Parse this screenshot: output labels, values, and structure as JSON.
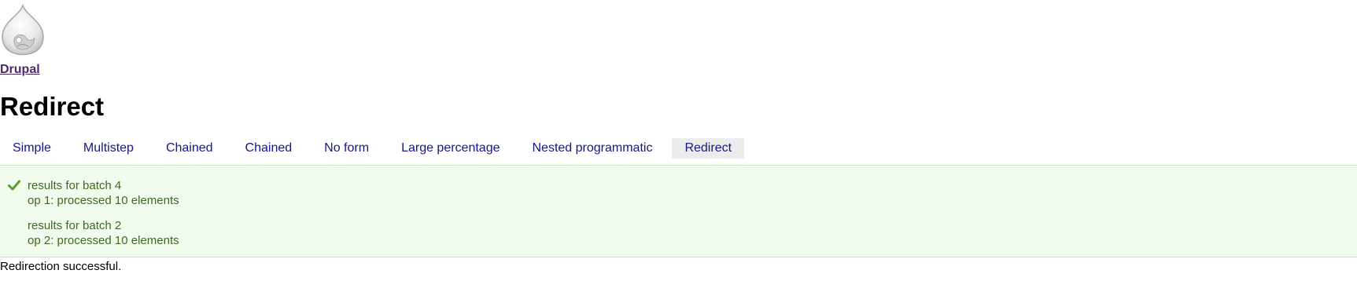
{
  "site": {
    "name": "Drupal",
    "logo_icon": "drupal-drop-icon"
  },
  "page": {
    "title": "Redirect"
  },
  "tabs": [
    {
      "label": "Simple",
      "active": false
    },
    {
      "label": "Multistep",
      "active": false
    },
    {
      "label": "Chained",
      "active": false
    },
    {
      "label": "Chained",
      "active": false
    },
    {
      "label": "No form",
      "active": false
    },
    {
      "label": "Large percentage",
      "active": false
    },
    {
      "label": "Nested programmatic",
      "active": false
    },
    {
      "label": "Redirect",
      "active": true
    }
  ],
  "messages": {
    "icon": "check-icon",
    "status_color": "#3f6a1f",
    "blocks": [
      {
        "lines": [
          "results for batch 4",
          "op 1: processed 10 elements"
        ]
      },
      {
        "lines": [
          "results for batch 2",
          "op 2: processed 10 elements"
        ]
      }
    ]
  },
  "content": {
    "status_text": "Redirection successful."
  },
  "colors": {
    "link": "#16168a",
    "site_name": "#4b2a6b",
    "message_bg": "#f1fbee",
    "active_tab_bg": "#ececec"
  }
}
